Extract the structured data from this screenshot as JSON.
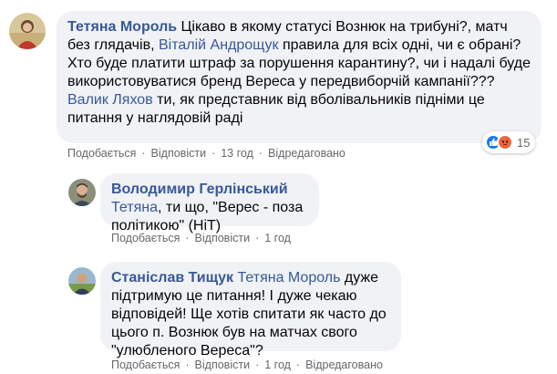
{
  "comments": [
    {
      "author": "Тетяна Мороль",
      "segments": [
        {
          "t": "Цікаво в якому статусі Вознюк на трибуні?, матч без глядачів, "
        },
        {
          "m": "Віталій Андрощук"
        },
        {
          "t": " правила для всіх одні, чи є обрані? Хто буде платити штраф за порушення карантину?, чи і надалі буде використовуватися бренд Вереса у передвиборчій кампанії??? "
        },
        {
          "m": "Валик Ляхов"
        },
        {
          "t": " ти, як представник від вболівальників підніми це питання у наглядовій раді"
        }
      ],
      "like_label": "Подобається",
      "reply_label": "Відповісти",
      "time": "13 год",
      "edited_label": "Відредаговано",
      "reaction_count": "15",
      "reactions": [
        "like",
        "angry"
      ]
    },
    {
      "author": "Володимир Герлінський",
      "segments": [
        {
          "m": "Тетяна"
        },
        {
          "t": ", ти що, \"Верес - поза політикою\" (НіТ)"
        }
      ],
      "like_label": "Подобається",
      "reply_label": "Відповісти",
      "time": "1 год"
    },
    {
      "author": "Станіслав Тищук",
      "segments": [
        {
          "m": "Тетяна Мороль"
        },
        {
          "t": " дуже підтримую це питання! І дуже чекаю відповідей! Ще хотів спитати як часто до цього п. Вознюк був на матчах свого \"улюбленого Вереса\"?"
        }
      ],
      "like_label": "Подобається",
      "reply_label": "Відповісти",
      "time": "1 год",
      "edited_label": "Відредаговано"
    }
  ],
  "colors": {
    "link": "#385898",
    "bubble": "#f0f2f5",
    "meta": "#65676b",
    "like": "#1877f2",
    "angry": "#f0663f"
  }
}
